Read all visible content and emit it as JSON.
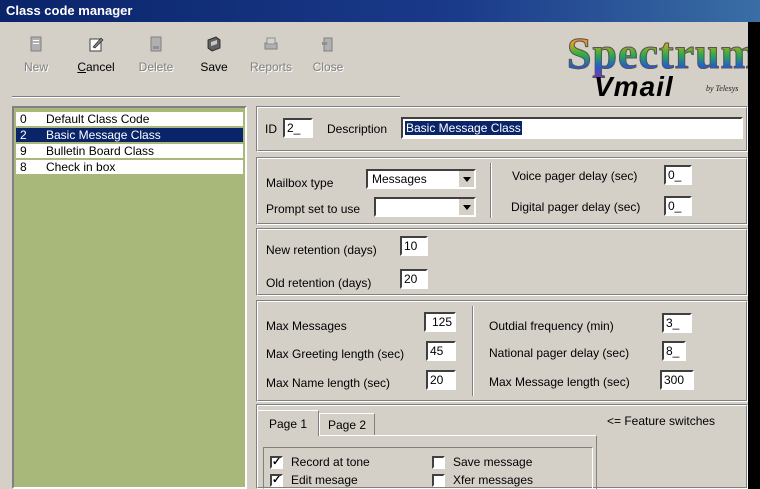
{
  "window": {
    "title": "Class code manager"
  },
  "toolbar": {
    "new_label": "New",
    "cancel_label": "Cancel",
    "cancel_mnemonic": "C",
    "cancel_rest": "ancel",
    "delete_label": "Delete",
    "save_label": "Save",
    "reports_label": "Reports",
    "close_label": "Close"
  },
  "logo": {
    "line1": "Spectrum",
    "line2": "Vmail",
    "byline": "by Telesys"
  },
  "class_list": [
    {
      "code": "0",
      "name": "Default Class Code",
      "selected": false
    },
    {
      "code": "2",
      "name": "Basic Message Class",
      "selected": true
    },
    {
      "code": "9",
      "name": "Bulletin Board Class",
      "selected": false
    },
    {
      "code": "8",
      "name": "Check in box",
      "selected": false
    }
  ],
  "header": {
    "id_label": "ID",
    "id_value": "2_",
    "description_label": "Description",
    "description_value": "Basic Message Class"
  },
  "mailbox": {
    "mailbox_type_label": "Mailbox type",
    "mailbox_type_value": "Messages",
    "prompt_set_label": "Prompt set to use",
    "prompt_set_value": "",
    "voice_pager_label": "Voice pager delay (sec)",
    "voice_pager_value": "0_",
    "digital_pager_label": "Digital pager delay (sec)",
    "digital_pager_value": "0_"
  },
  "retention": {
    "new_label": "New retention (days)",
    "new_value": "10",
    "old_label": "Old retention (days)",
    "old_value": "20"
  },
  "limits": {
    "max_messages_label": "Max Messages",
    "max_messages_value": "125",
    "max_greeting_label": "Max Greeting length (sec)",
    "max_greeting_value": "45",
    "max_name_label": "Max Name length (sec)",
    "max_name_value": "20",
    "outdial_label": "Outdial frequency (min)",
    "outdial_value": "3_",
    "national_pager_label": "National pager delay (sec)",
    "national_pager_value": "8_",
    "max_message_label": "Max Message length (sec)",
    "max_message_value": "300"
  },
  "features": {
    "tab1": "Page 1",
    "tab2": "Page 2",
    "switches_note": "<= Feature switches",
    "checkboxes": [
      {
        "label": "Record at tone",
        "checked": true
      },
      {
        "label": "Save message",
        "checked": false
      },
      {
        "label": "Edit mesage",
        "checked": true
      },
      {
        "label": "Xfer messages",
        "checked": false
      }
    ]
  }
}
